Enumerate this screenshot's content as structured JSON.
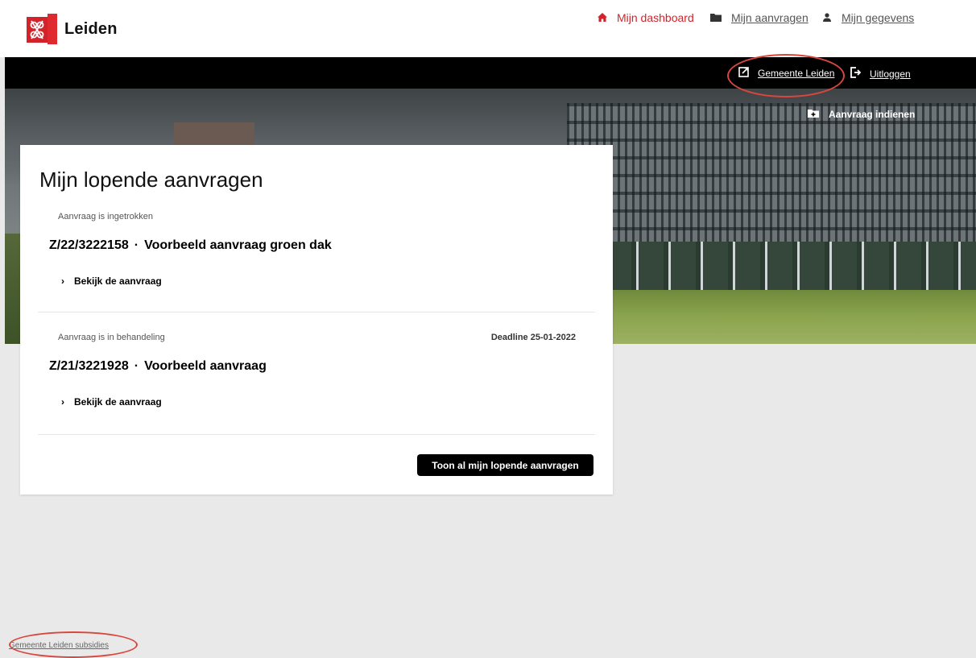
{
  "header": {
    "logo_text": "Leiden",
    "nav": [
      {
        "label": "Mijn dashboard",
        "icon": "home-icon",
        "active": true
      },
      {
        "label": "Mijn aanvragen",
        "icon": "folder-icon",
        "active": false
      },
      {
        "label": "Mijn gegevens",
        "icon": "user-icon",
        "active": false
      }
    ]
  },
  "utility_bar": {
    "gemeente_label": "Gemeente Leiden",
    "gemeente_icon": "external-link-icon",
    "logout_label": "Uitloggen",
    "logout_icon": "logout-icon"
  },
  "hero": {
    "cta_label": "Aanvraag indienen",
    "cta_icon": "folder-plus-icon"
  },
  "card": {
    "title": "Mijn lopende aanvragen",
    "requests": [
      {
        "status": "Aanvraag is ingetrokken",
        "deadline": "",
        "number": "Z/22/3222158",
        "separator": "·",
        "name": "Voorbeeld aanvraag groen dak",
        "link": "Bekijk de aanvraag"
      },
      {
        "status": "Aanvraag is in behandeling",
        "deadline": "Deadline 25-01-2022",
        "number": "Z/21/3221928",
        "separator": "·",
        "name": "Voorbeeld aanvraag",
        "link": "Bekijk de aanvraag"
      }
    ],
    "show_all_button": "Toon al mijn lopende aanvragen"
  },
  "footer": {
    "link": "Gemeente Leiden subsidies"
  },
  "colors": {
    "brand_red": "#d2232a",
    "annotation_red": "#d8473e",
    "black": "#000000",
    "page_bg": "#e9e9e9"
  }
}
